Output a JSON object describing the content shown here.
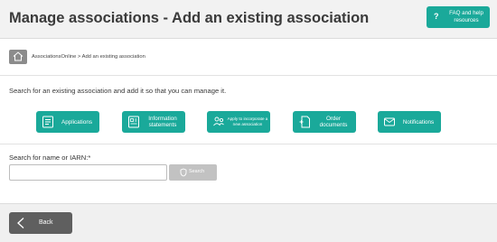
{
  "header": {
    "title": "Manage associations - Add an existing association",
    "help_button": {
      "icon": "question-icon",
      "label": "FAQ and help resources"
    }
  },
  "breadcrumb": {
    "home_icon": "home-icon",
    "text": "AssociationsOnline > Add an existing association"
  },
  "intro_text": "Search for an existing association and add it so that you can manage it.",
  "quick_links": [
    {
      "icon": "applications-icon",
      "label": "Applications"
    },
    {
      "icon": "information-statements-icon",
      "label": "Information statements"
    },
    {
      "icon": "incorporate-icon",
      "label": "Apply to incorporate a new association"
    },
    {
      "icon": "order-documents-icon",
      "label": "Order documents"
    },
    {
      "icon": "notifications-icon",
      "label": "Notifications"
    }
  ],
  "search": {
    "label": "Search for name or IARN:*",
    "value": "",
    "placeholder": "",
    "button_label": "Search",
    "button_icon": "search-icon"
  },
  "footer": {
    "back_label": "Back",
    "back_icon": "chevron-left-icon"
  },
  "colors": {
    "accent": "#1aa99a",
    "header_bg": "#f2f2f2",
    "back_button": "#5f5f5f",
    "disabled_button": "#c2c2c2"
  }
}
